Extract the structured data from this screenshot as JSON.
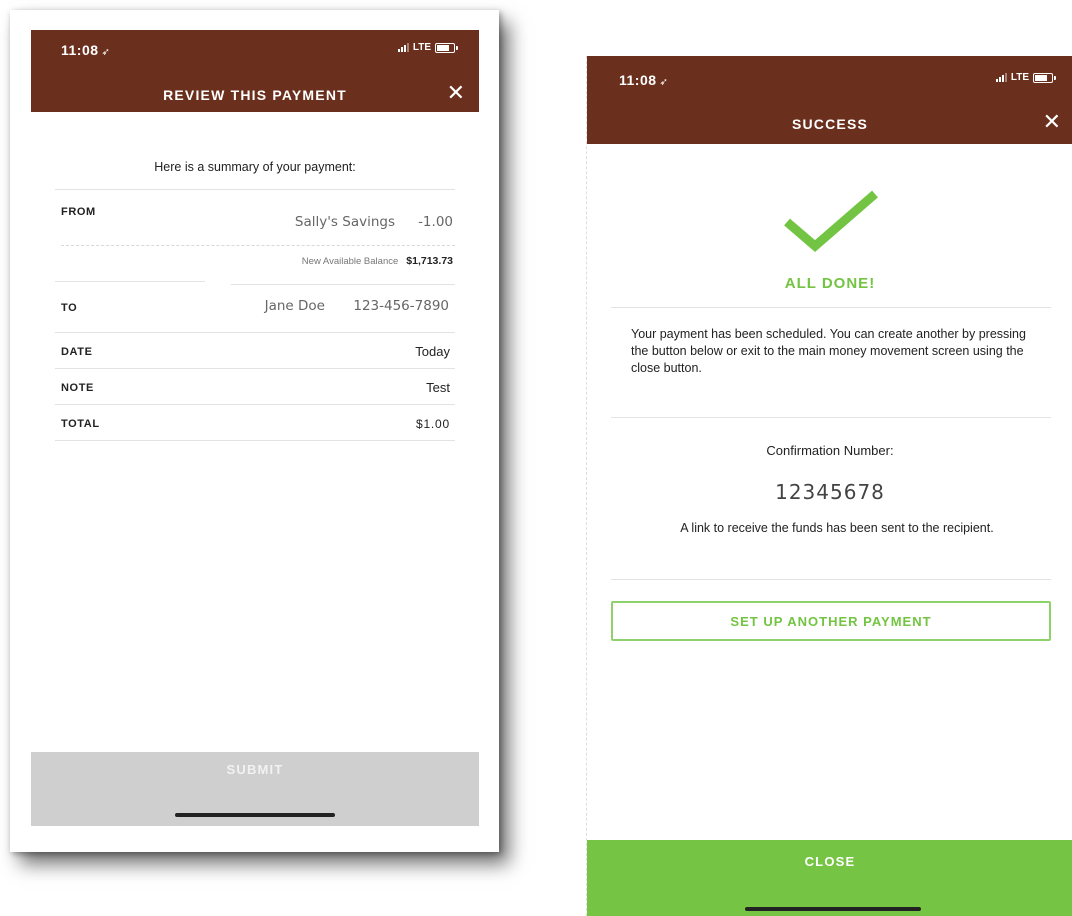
{
  "review_screen": {
    "status": {
      "time": "11:08",
      "location_glyph": "➶",
      "network": "LTE"
    },
    "title": "REVIEW THIS PAYMENT",
    "close_glyph": "✕",
    "summary_heading": "Here is a summary of your payment:",
    "from": {
      "label": "FROM",
      "account": "Sally's Savings",
      "amount": "-1.00",
      "balance_label": "New Available Balance",
      "balance_value": "$1,713.73"
    },
    "to": {
      "label": "TO",
      "name": "Jane Doe",
      "phone": "123-456-7890"
    },
    "date": {
      "label": "DATE",
      "value": "Today"
    },
    "note": {
      "label": "NOTE",
      "value": "Test"
    },
    "total": {
      "label": "TOTAL",
      "value": "$1.00"
    },
    "submit_label": "SUBMIT"
  },
  "success_screen": {
    "status": {
      "time": "11:08",
      "location_glyph": "➶",
      "network": "LTE"
    },
    "title": "SUCCESS",
    "close_glyph": "✕",
    "done_heading": "ALL DONE!",
    "message": "Your payment has been scheduled. You can create another by pressing the button below or exit to the main money movement screen using the close button.",
    "confirmation_label": "Confirmation Number:",
    "confirmation_number": "12345678",
    "link_message": "A link to receive the funds has been sent to the recipient.",
    "another_payment_label": "SET UP ANOTHER PAYMENT",
    "close_label": "CLOSE"
  },
  "colors": {
    "header_brown": "#6b2f1d",
    "success_green": "#76c443",
    "submit_disabled_gray": "#cfcfcf"
  },
  "icons": {
    "close": "close-icon",
    "check": "checkmark-icon",
    "location": "location-arrow-icon",
    "signal": "signal-icon",
    "battery": "battery-icon"
  }
}
